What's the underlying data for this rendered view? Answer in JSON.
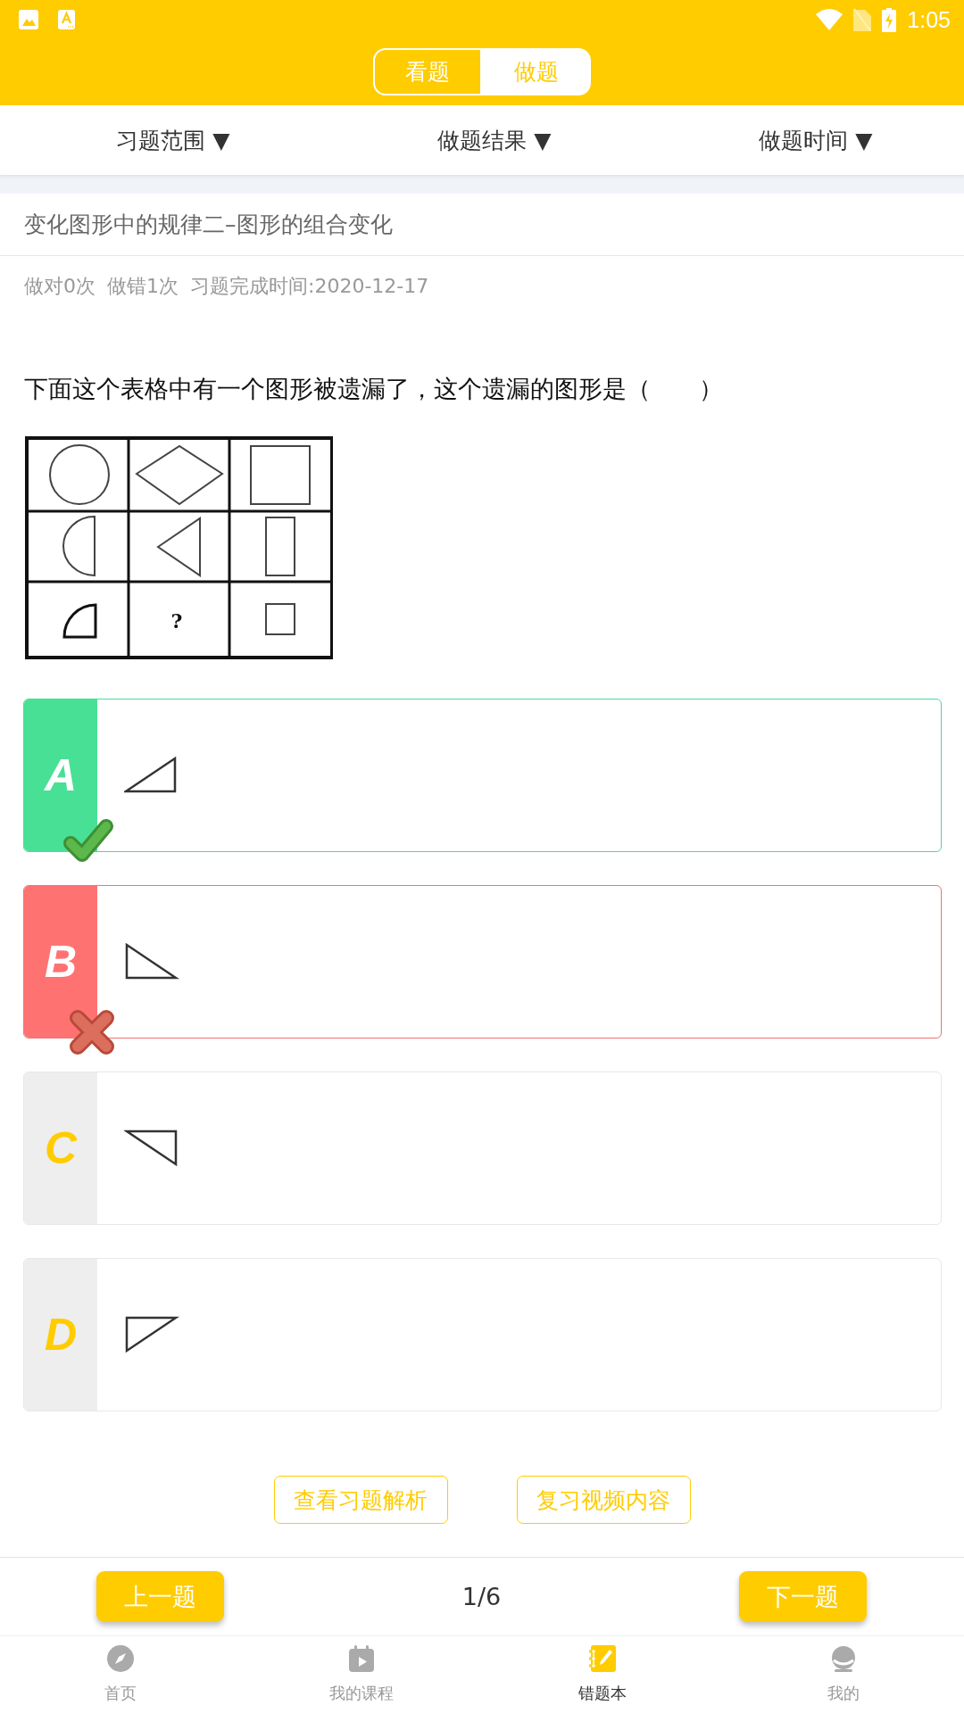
{
  "status_bar": {
    "time": "1:05"
  },
  "mode_toggle": [
    {
      "label": "看题",
      "selected": false
    },
    {
      "label": "做题",
      "selected": true
    }
  ],
  "filters": [
    {
      "label": "习题范围 ▼"
    },
    {
      "label": "做题结果 ▼"
    },
    {
      "label": "做题时间 ▼"
    }
  ],
  "exercise": {
    "title": "变化图形中的规律二–图形的组合变化",
    "stats": [
      "做对0次",
      "做错1次",
      "习题完成时间:2020-12-17"
    ],
    "question": "下面这个表格中有一个图形被遗漏了，这个遗漏的图形是（　　）",
    "figure": {
      "missing_mark": "?"
    }
  },
  "options": [
    {
      "letter": "A",
      "kind": "southeast",
      "correct": true,
      "selected": false
    },
    {
      "letter": "B",
      "kind": "southwest",
      "correct": false,
      "selected": true
    },
    {
      "letter": "C",
      "kind": "northeast",
      "correct": false,
      "selected": false
    },
    {
      "letter": "D",
      "kind": "northwest",
      "correct": false,
      "selected": false
    }
  ],
  "actions": [
    "查看习题解析",
    "复习视频内容"
  ],
  "pager": {
    "previous": "上一题",
    "position": "1/6",
    "next": "下一题"
  },
  "tab_bar": [
    {
      "label": "首页",
      "selected": false
    },
    {
      "label": "我的课程",
      "selected": false
    },
    {
      "label": "错题本",
      "selected": true
    },
    {
      "label": "我的",
      "selected": false
    }
  ]
}
